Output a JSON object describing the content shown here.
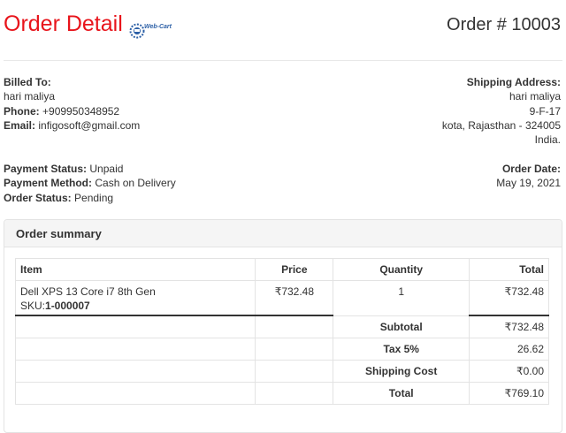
{
  "header": {
    "title": "Order Detail",
    "logo_text": "Web-Cart",
    "order_number": "Order # 10003"
  },
  "billing": {
    "heading": "Billed To:",
    "name": "hari maliya",
    "phone_label": "Phone:",
    "phone": "+909950348952",
    "email_label": "Email:",
    "email": "infigosoft@gmail.com"
  },
  "shipping": {
    "heading": "Shipping Address:",
    "name": "hari maliya",
    "line1": "9-F-17",
    "line2": "kota, Rajasthan - 324005",
    "country": "India."
  },
  "status": {
    "payment_status_label": "Payment Status:",
    "payment_status": "Unpaid",
    "payment_method_label": "Payment Method:",
    "payment_method": "Cash on Delivery",
    "order_status_label": "Order Status:",
    "order_status": "Pending"
  },
  "order_date": {
    "label": "Order Date:",
    "value": "May 19, 2021"
  },
  "summary": {
    "title": "Order summary",
    "columns": [
      "Item",
      "Price",
      "Quantity",
      "Total"
    ],
    "items": [
      {
        "name": "Dell XPS 13 Core i7 8th Gen",
        "sku_label": "SKU:",
        "sku": "1-000007",
        "price": "₹732.48",
        "quantity": "1",
        "total": "₹732.48"
      }
    ],
    "totals": {
      "subtotal_label": "Subtotal",
      "subtotal": "₹732.48",
      "tax_label": "Tax 5%",
      "tax": "26.62",
      "shipping_label": "Shipping Cost",
      "shipping": "₹0.00",
      "total_label": "Total",
      "total": "₹769.10"
    }
  },
  "colors": {
    "title": "#e8141b",
    "text": "#333333",
    "panel_header": "#f5f5f5",
    "border": "#e3e3e3",
    "logo_blue": "#2b5fa6"
  }
}
